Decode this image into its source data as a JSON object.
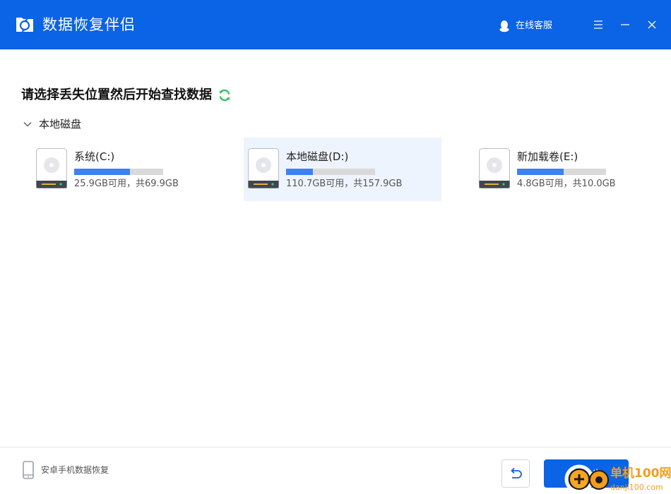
{
  "header": {
    "app_title": "数据恢复伴侣",
    "support_label": "在线客服"
  },
  "main": {
    "title": "请选择丢失位置然后开始查找数据",
    "section_label": "本地磁盘",
    "disks": [
      {
        "name": "系统(C:)",
        "space_text": "25.9GB可用，共69.9GB",
        "used_fraction": 0.63
      },
      {
        "name": "本地磁盘(D:)",
        "space_text": "110.7GB可用，共157.9GB",
        "used_fraction": 0.3,
        "selected": true
      },
      {
        "name": "新加载卷(E:)",
        "space_text": "4.8GB可用，共10.0GB",
        "used_fraction": 0.52
      }
    ]
  },
  "footer": {
    "android_label": "安卓手机数据恢复",
    "next_label": "下一步"
  },
  "watermark": {
    "brand": "单机100网",
    "url": "danji100.com"
  },
  "colors": {
    "accent": "#0b63e5",
    "bar_fill": "#3d82f2",
    "bar_track": "#d9d9d9",
    "refresh": "#2ec65a",
    "selected_bg": "#eef4fd"
  },
  "icons": {
    "logo": "recovery-logo-icon",
    "support": "qq-penguin-icon",
    "menu": "hamburger-menu-icon",
    "minimize": "minimize-icon",
    "close": "close-icon",
    "refresh": "refresh-icon",
    "chevron": "chevron-down-icon",
    "disk": "hard-disk-icon",
    "phone": "phone-icon",
    "back": "undo-arrow-icon"
  }
}
